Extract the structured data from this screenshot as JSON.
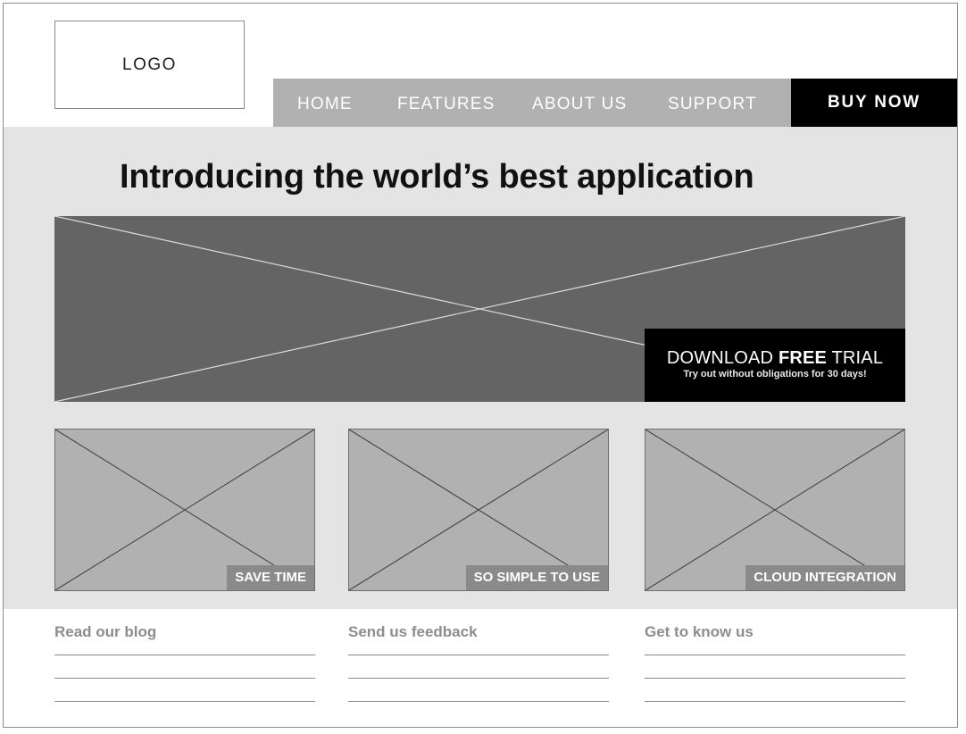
{
  "header": {
    "logo_text": "LOGO",
    "nav": [
      {
        "label": "HOME"
      },
      {
        "label": "FEATURES"
      },
      {
        "label": "ABOUT US"
      },
      {
        "label": "SUPPORT"
      }
    ],
    "buy_now": "BUY NOW"
  },
  "hero": {
    "headline": "Introducing the world’s best application",
    "cta": {
      "title_pre": "DOWNLOAD ",
      "title_bold": "FREE",
      "title_post": " TRIAL",
      "subtitle": "Try out without obligations for 30 days!"
    }
  },
  "features": [
    {
      "label": "SAVE TIME"
    },
    {
      "label": "SO SIMPLE TO USE"
    },
    {
      "label": "CLOUD INTEGRATION"
    }
  ],
  "footer": [
    {
      "title": "Read our blog"
    },
    {
      "title": "Send us feedback"
    },
    {
      "title": "Get to know us"
    }
  ],
  "colors": {
    "hero_background": "#646464",
    "tile_background": "#b1b1b1",
    "band_background": "#e4e4e4",
    "nav_background": "#b1b1b1",
    "cta_background": "#000000"
  },
  "icons": {
    "image_placeholder": "image-placeholder-icon"
  }
}
